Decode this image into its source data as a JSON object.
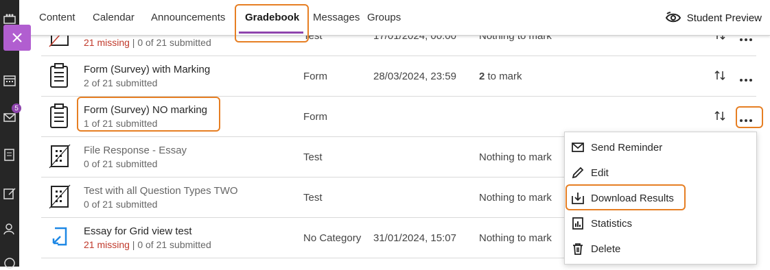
{
  "tabs": [
    "Content",
    "Calendar",
    "Announcements",
    "Gradebook",
    "Messages",
    "Groups"
  ],
  "student_preview": "Student Preview",
  "leftnav": {
    "messages_badge": "5"
  },
  "rows": [
    {
      "title": "",
      "status_missing": "21 missing",
      "status_rest": " | 0 of 21 submitted",
      "category": "Test",
      "due": "17/01/2024, 00:00",
      "marking": "Nothing to mark",
      "icon": "test-icon"
    },
    {
      "title": "Form (Survey) with Marking",
      "status": "2 of 21 submitted",
      "category": "Form",
      "due": "28/03/2024, 23:59",
      "marking_count": "2",
      "marking_rest": " to mark",
      "icon": "form-icon"
    },
    {
      "title": "Form (Survey) NO marking",
      "status": "1 of 21 submitted",
      "category": "Form",
      "due": "",
      "marking": "",
      "icon": "form-icon"
    },
    {
      "title": "File Response - Essay",
      "status": "0 of 21 submitted",
      "category": "Test",
      "due": "",
      "marking": "Nothing to mark",
      "icon": "test-icon"
    },
    {
      "title": "Test with all Question Types TWO",
      "status": "0 of 21 submitted",
      "category": "Test",
      "due": "",
      "marking": "Nothing to mark",
      "icon": "test-icon"
    },
    {
      "title": "Essay for Grid view test",
      "status_missing": "21 missing",
      "status_rest": " | 0 of 21 submitted",
      "category": "No Category",
      "due": "31/01/2024, 15:07",
      "marking": "Nothing to mark",
      "icon": "assignment-icon"
    }
  ],
  "menu": [
    "Send Reminder",
    "Edit",
    "Download Results",
    "Statistics",
    "Delete"
  ],
  "colors": {
    "accent": "#8e44ad",
    "highlight": "#e67e22",
    "missing": "#c0392b",
    "close": "#b15ed0"
  }
}
